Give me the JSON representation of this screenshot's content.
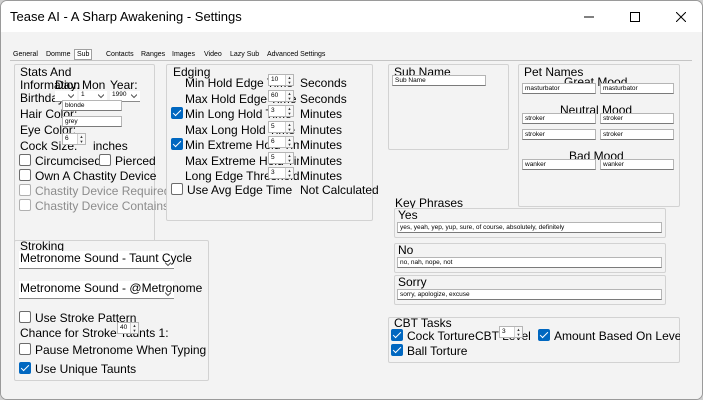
{
  "window": {
    "title": "Tease AI - A Sharp Awakening - Settings"
  },
  "tabs": [
    "General",
    "Domme",
    "Sub",
    "Contacts",
    "Ranges",
    "Images",
    "Video",
    "Lazy Sub",
    "Advanced Settings"
  ],
  "stats": {
    "title_line1": "Stats And",
    "title_line2": "Information",
    "birthday_label": "Birthday:",
    "day_label": "Day:",
    "month_label": "Mon",
    "year_label": "Year:",
    "day_value": "",
    "month_value": "1",
    "year_value": "1990",
    "hair_label": "Hair Color:",
    "hair_value": "blonde",
    "eye_label": "Eye Color:",
    "eye_value": "grey",
    "cock_label": "Cock Size:",
    "cock_value": "6",
    "cock_unit": "inches",
    "circumcised_label": "Circumcised",
    "pierced_label": "Pierced",
    "chastity_device_label": "Own A Chastity Device",
    "chastity_required_label": "Chastity Device Required",
    "chastity_contains_label": "Chastity Device Contains"
  },
  "edging": {
    "title": "Edging",
    "rows": [
      {
        "label": "Min Hold Edge Time",
        "value": "10",
        "unit": "Seconds",
        "checked": null
      },
      {
        "label": "Max Hold Edge Time",
        "value": "60",
        "unit": "Seconds",
        "checked": null
      },
      {
        "label": "Min Long Hold Time",
        "value": "3",
        "unit": "Minutes",
        "checked": true
      },
      {
        "label": "Max Long Hold Time",
        "value": "5",
        "unit": "Minutes",
        "checked": null
      },
      {
        "label": "Min Extreme Hold Time",
        "value": "6",
        "unit": "Minutes",
        "checked": true
      },
      {
        "label": "Max Extreme Hold Time",
        "value": "5",
        "unit": "Minutes",
        "checked": null
      },
      {
        "label": "Long Edge Threshold",
        "value": "3",
        "unit": "Minutes",
        "checked": null
      }
    ],
    "avg_label": "Use Avg Edge Time",
    "not_calculated": "Not Calculated"
  },
  "subname": {
    "title": "Sub Name",
    "value": "Sub Name"
  },
  "petnames": {
    "title": "Pet Names",
    "great_mood": "Great Mood",
    "neutral_mood": "Neutral Mood",
    "bad_mood": "Bad Mood",
    "great": [
      "masturbator",
      "masturbator"
    ],
    "neutral": [
      "stroker",
      "stroker",
      "stroker",
      "stroker"
    ],
    "bad": [
      "wanker",
      "wanker"
    ]
  },
  "keyphrases": {
    "title": "Key Phrases",
    "yes_label": "Yes",
    "yes_value": "yes, yeah, yep, yup, sure, of course, absolutely, definitely",
    "no_label": "No",
    "no_value": "no, nah, nope, not",
    "sorry_label": "Sorry",
    "sorry_value": "sorry, apologize, excuse"
  },
  "stroking": {
    "title": "Stroking",
    "taunt_combo_label": "Metronome Sound - Taunt Cycle",
    "metronome_combo_label": "Metronome Sound - @Metronome",
    "stroke_pattern_label": "Use Stroke Pattern",
    "chance_label": "Chance for Stroke Taunts 1:",
    "chance_value": "40",
    "pause_label": "Pause Metronome When Typing",
    "unique_label": "Use Unique Taunts"
  },
  "cbt": {
    "title": "CBT Tasks",
    "cock_label": "Cock Torture",
    "cock_level_label": "CBT Level",
    "cock_level_value": "3",
    "amount_label": "Amount Based On Level",
    "ball_label": "Ball Torture"
  }
}
